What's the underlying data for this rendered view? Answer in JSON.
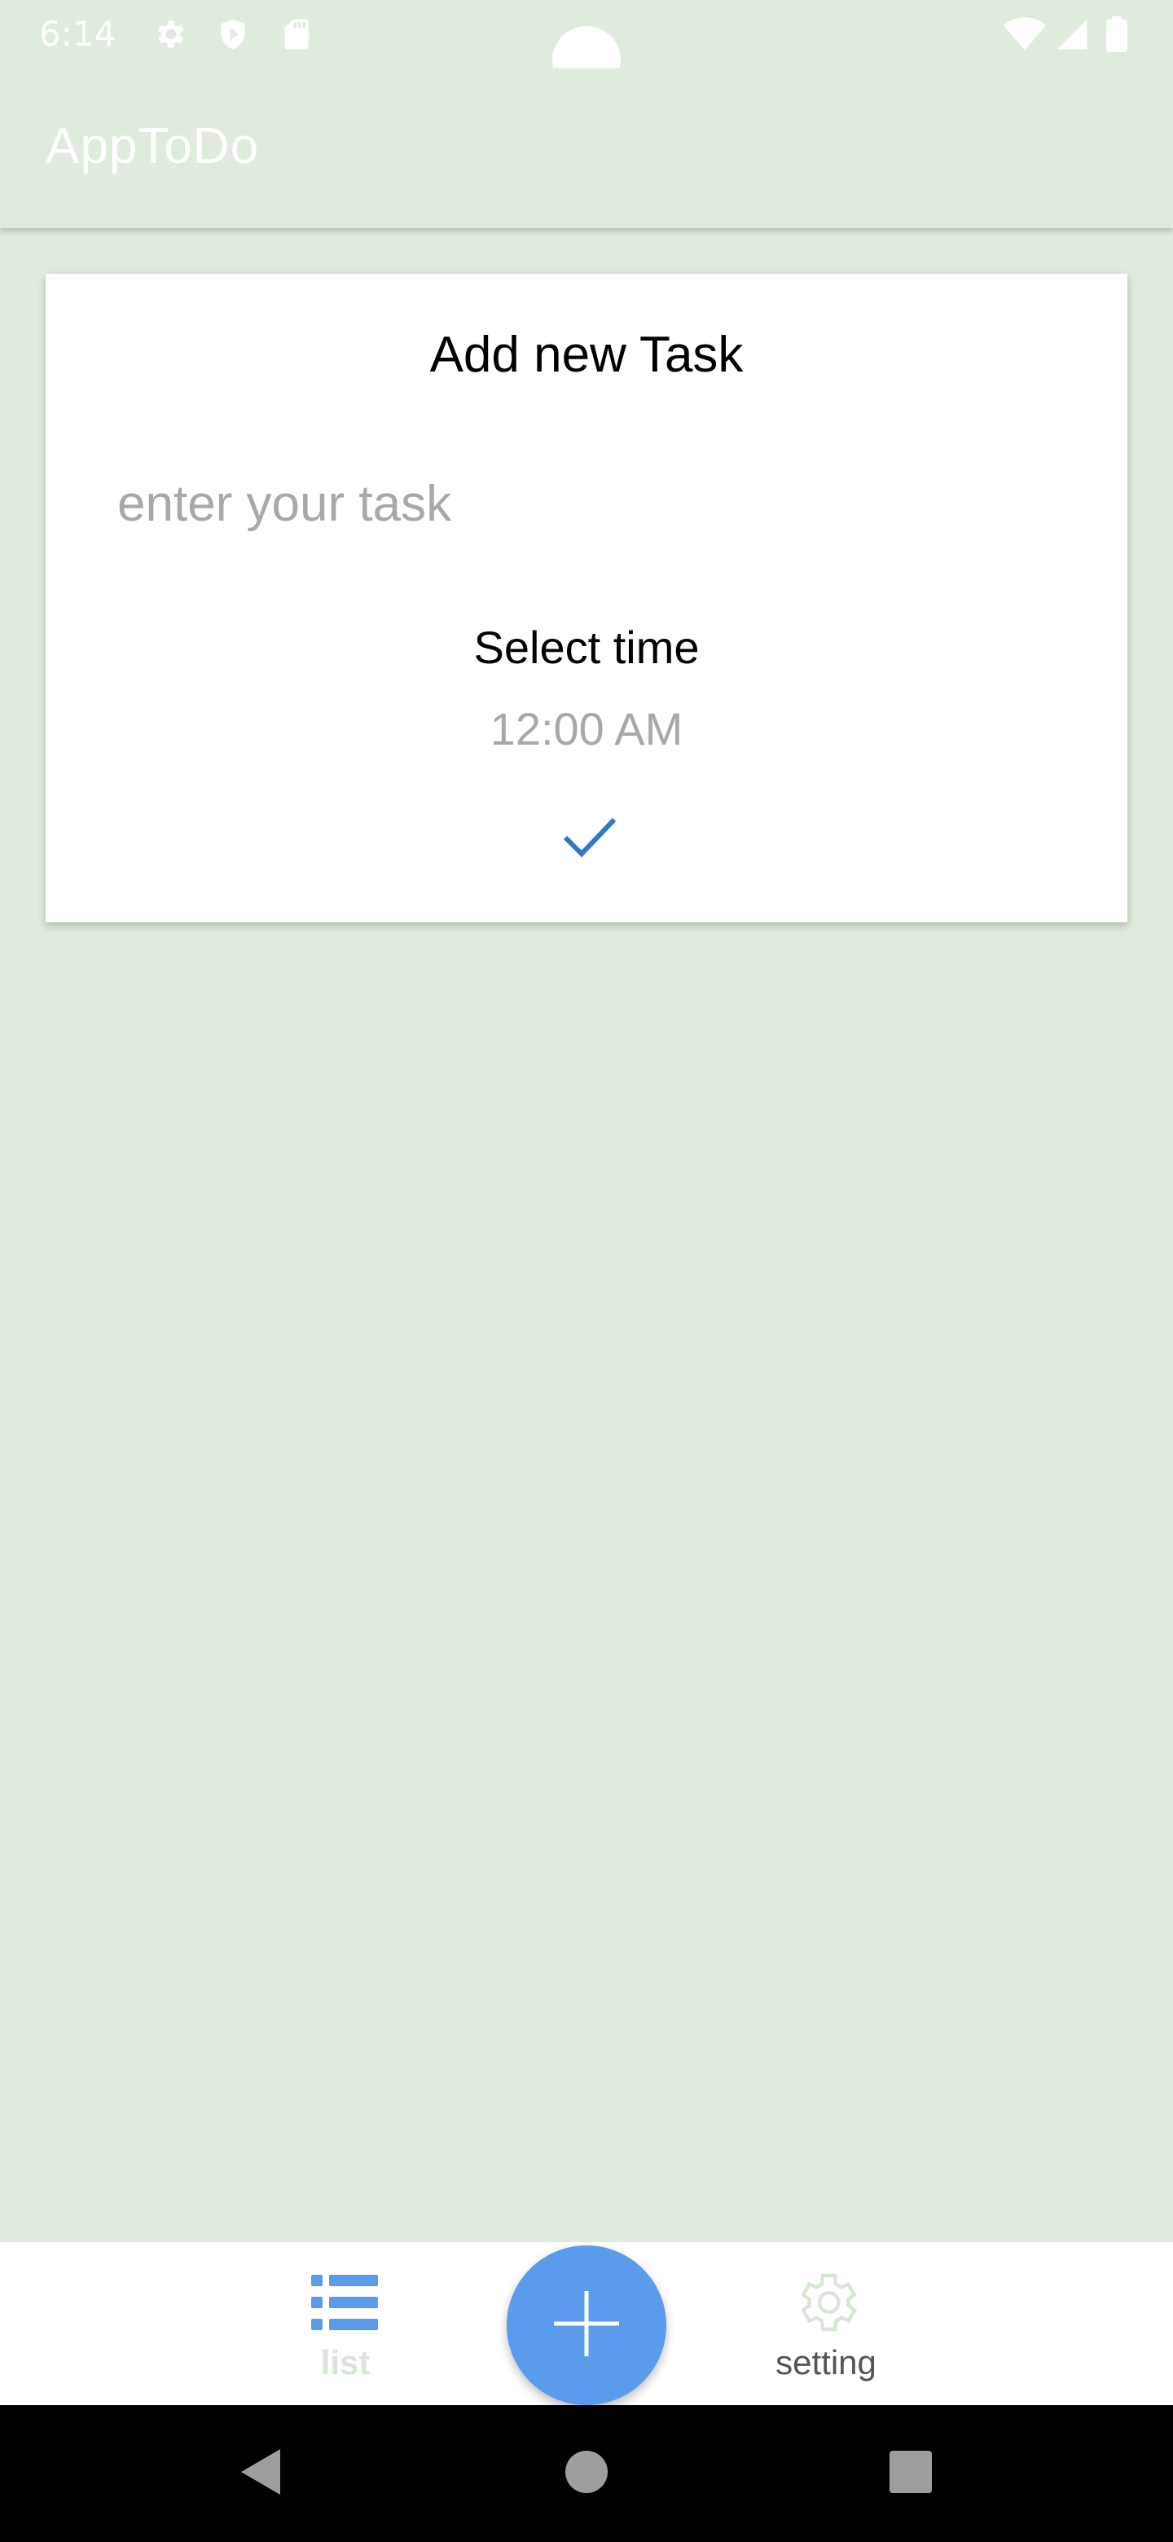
{
  "status_bar": {
    "time": "6:14",
    "icons": [
      "settings-icon",
      "shield-play-icon",
      "sd-card-icon",
      "wifi-icon",
      "cell-signal-icon",
      "battery-icon"
    ]
  },
  "app_bar": {
    "title": "AppToDo"
  },
  "add_task_card": {
    "title": "Add new Task",
    "task_input": {
      "value": "",
      "placeholder": "enter your task"
    },
    "select_time_label": "Select time",
    "time_value": "12:00 AM",
    "confirm_icon": "check-icon"
  },
  "bottom_nav": {
    "items": [
      {
        "label": "list",
        "icon": "list-icon",
        "selected": true
      },
      {
        "label": "setting",
        "icon": "gear-icon",
        "selected": false
      }
    ],
    "fab_icon": "plus-icon"
  },
  "system_nav": {
    "buttons": [
      "back-icon",
      "home-icon",
      "recents-icon"
    ]
  },
  "colors": {
    "background": "#DFEBDC",
    "accent": "#5B9BEB",
    "check": "#2F78C4",
    "hint_text": "#A8A8A8",
    "list_label": "#D6E8D3"
  }
}
